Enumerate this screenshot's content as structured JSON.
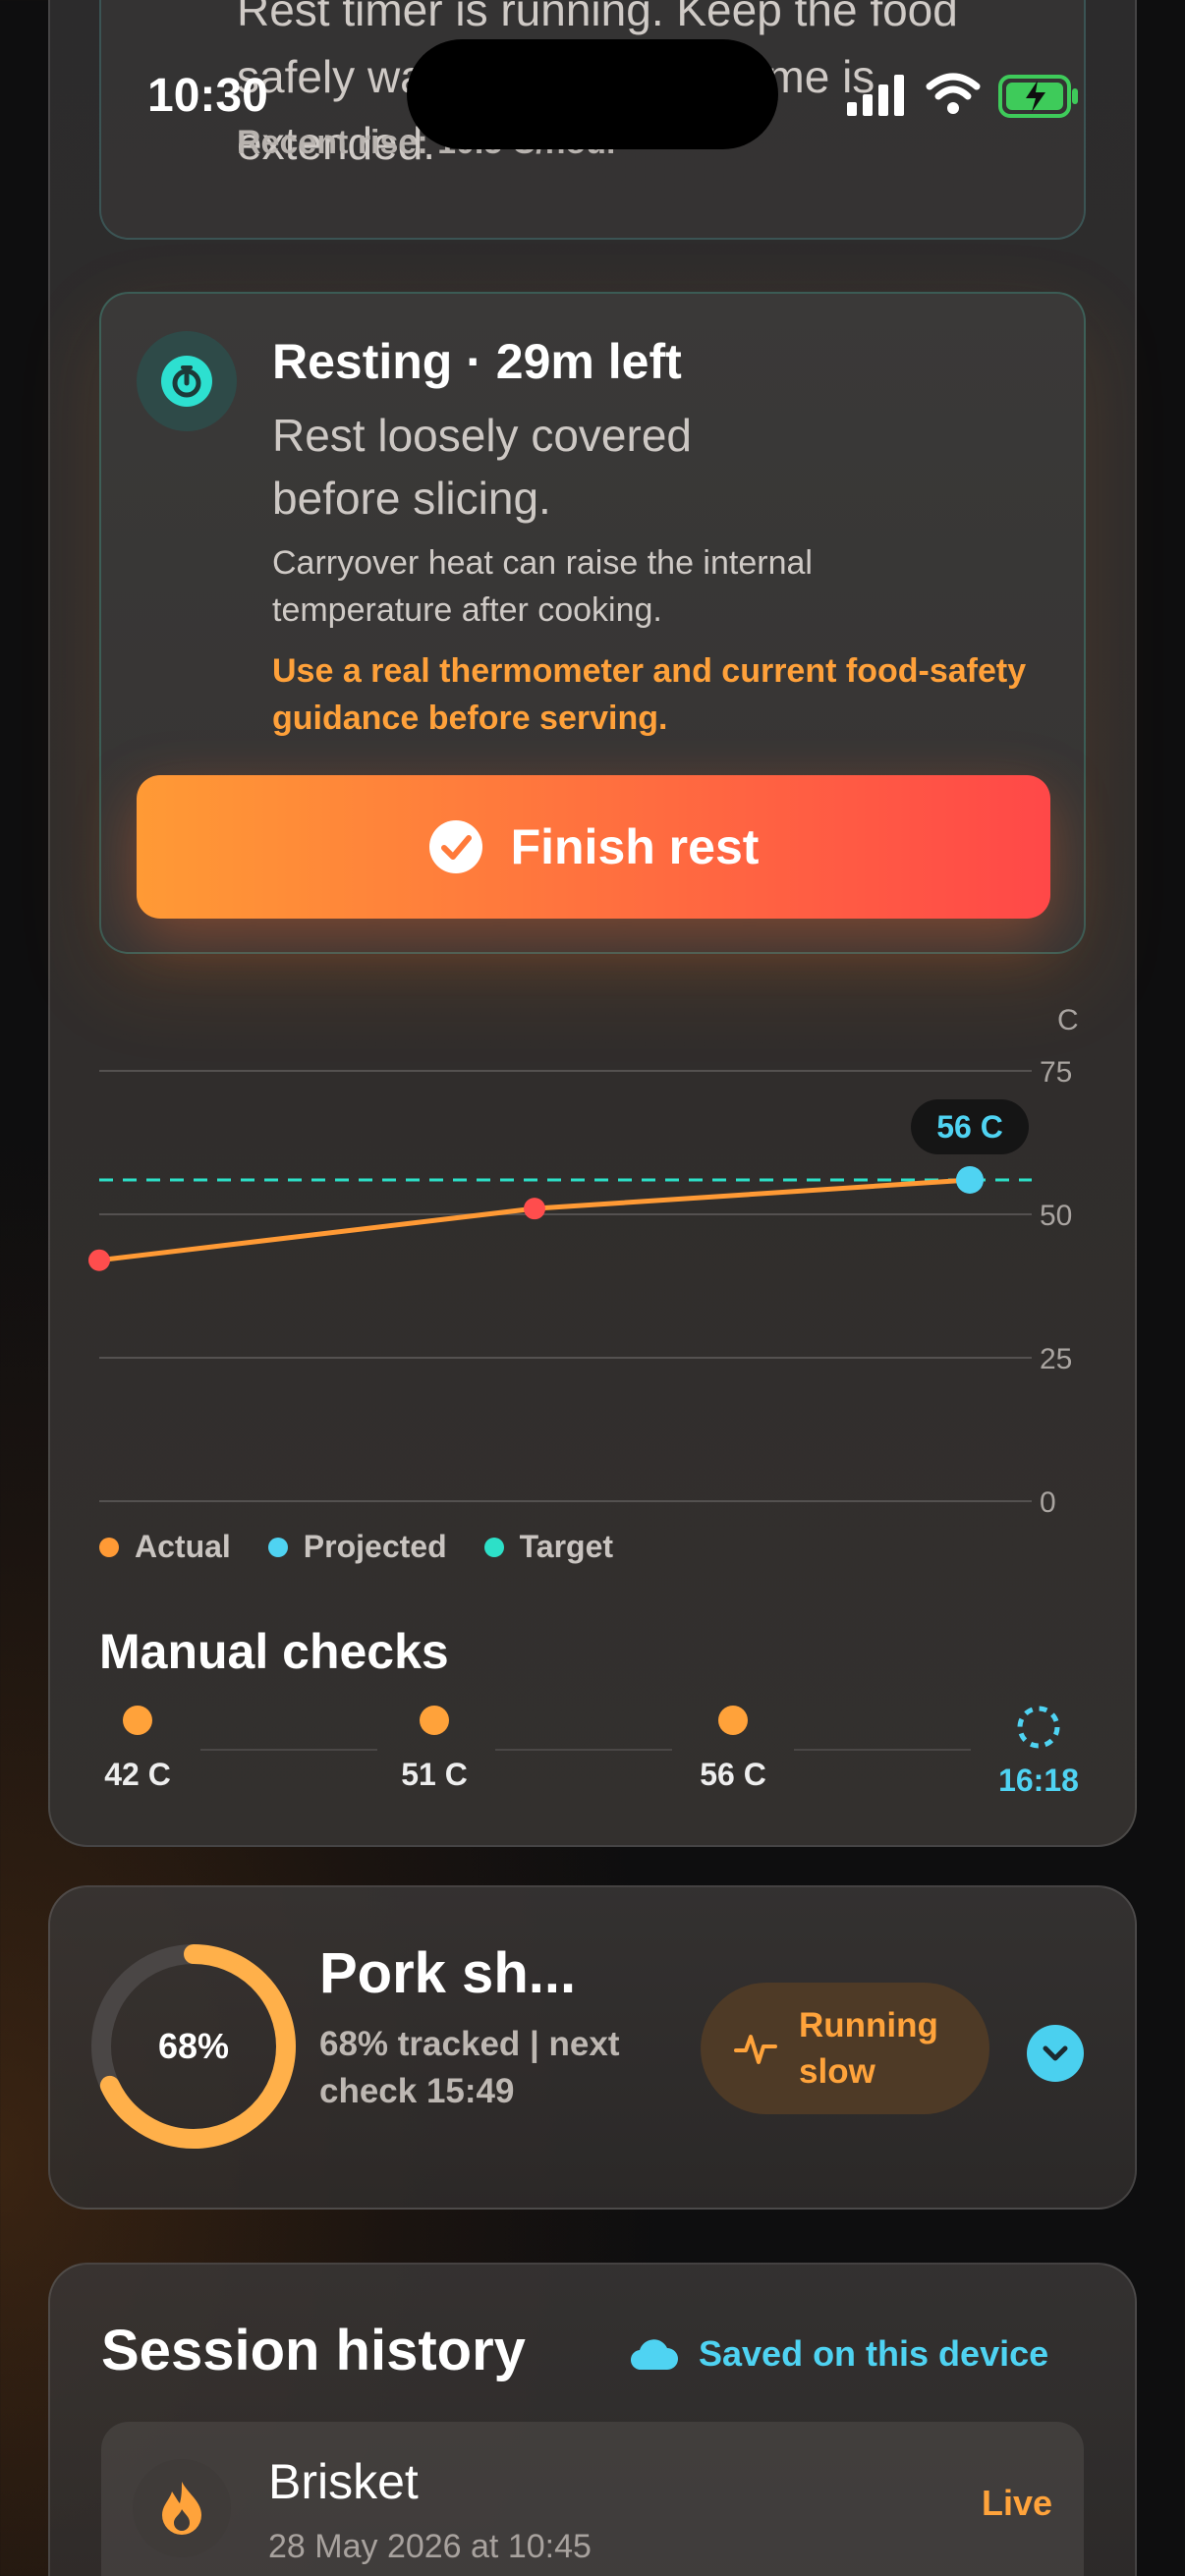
{
  "status_bar": {
    "time": "10:30"
  },
  "alert": {
    "text": "Rest timer is running. Keep the food safely warm until serving time is extended.",
    "recent_rise": "Recent rise: 10.5 C/hour"
  },
  "rest_card": {
    "title": "Resting · 29m left",
    "subtitle": "Rest loosely covered before slicing.",
    "note": "Carryover heat can raise the internal temperature after cooking.",
    "warning": "Use a real thermometer and current food-safety guidance before serving.",
    "finish_label": "Finish rest"
  },
  "chart_data": {
    "type": "line",
    "ylabel": "C",
    "ylim": [
      0,
      75
    ],
    "yticks": [
      "75",
      "50",
      "25",
      "0"
    ],
    "actual": {
      "x": [
        0,
        1,
        2
      ],
      "y": [
        42,
        51,
        56
      ]
    },
    "target": 56,
    "projected_point": {
      "x": 2,
      "y": 56,
      "label": "56 C"
    },
    "legend": [
      "Actual",
      "Projected",
      "Target"
    ],
    "colors": {
      "actual": "#ff9a35",
      "projected": "#4fd3f2",
      "target": "#2de0c8",
      "point": "#ff4d4d"
    }
  },
  "manual_checks": {
    "title": "Manual checks",
    "items": [
      "42 C",
      "51 C",
      "56 C"
    ],
    "next": "16:18"
  },
  "summary": {
    "progress_label": "68%",
    "progress": 0.68,
    "title": "Pork sh...",
    "subtitle": "68% tracked | next check 15:49",
    "status": "Running slow"
  },
  "history": {
    "title": "Session history",
    "saved": "Saved on this device",
    "rows": [
      {
        "name": "Brisket",
        "date": "28 May 2026 at 10:45",
        "status": "Live"
      }
    ]
  }
}
